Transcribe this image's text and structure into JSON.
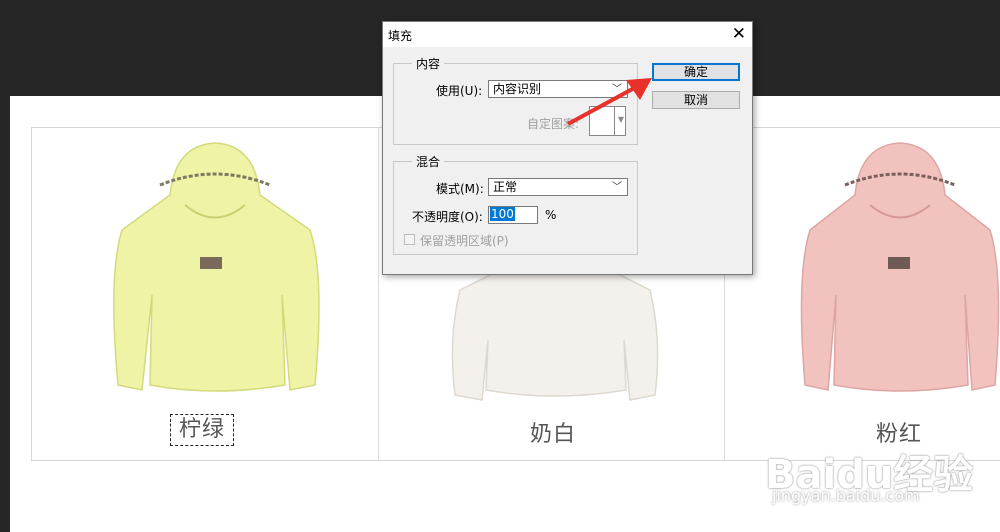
{
  "products": [
    {
      "name": "柠绿",
      "color": "#eef3a6"
    },
    {
      "name": "奶白",
      "color": "#f4f1ec"
    },
    {
      "name": "粉红",
      "color": "#f2c2bf"
    }
  ],
  "watermark": {
    "logo": "Baidu经验",
    "url": "jingyan.baidu.com"
  },
  "dialog": {
    "title": "填充",
    "close_icon": "close-icon",
    "contents_group": {
      "title": "内容",
      "use_label": "使用(U):",
      "use_value": "内容识别",
      "custom_pattern_label": "自定图案:"
    },
    "blending_group": {
      "title": "混合",
      "mode_label": "模式(M):",
      "mode_value": "正常",
      "opacity_label": "不透明度(O):",
      "opacity_value": "100",
      "opacity_unit": "%",
      "preserve_transparency_label": "保留透明区域(P)"
    },
    "ok_label": "确定",
    "cancel_label": "取消"
  },
  "colors": {
    "accent": "#0078d7",
    "arrow": "#e8312a"
  }
}
